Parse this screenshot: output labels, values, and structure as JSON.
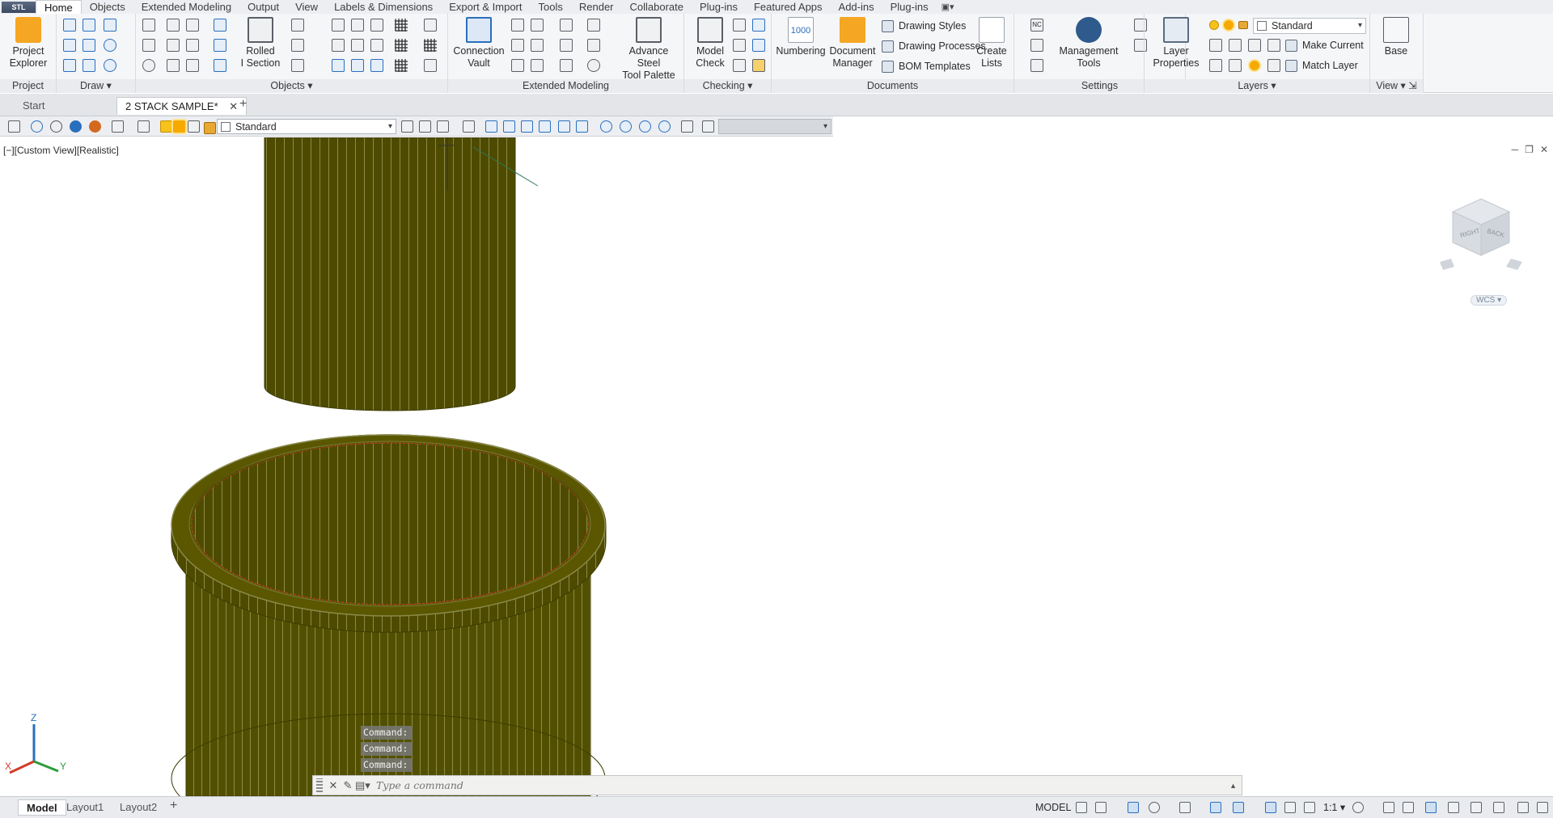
{
  "app_button": "STL",
  "tabs": [
    "Home",
    "Objects",
    "Extended Modeling",
    "Output",
    "View",
    "Labels & Dimensions",
    "Export & Import",
    "Tools",
    "Render",
    "Collaborate",
    "Plug-ins",
    "Featured Apps",
    "Add-ins",
    "Plug-ins"
  ],
  "active_tab": "Home",
  "ribbon": {
    "project": {
      "label": "Project",
      "explorer": "Project\nExplorer"
    },
    "draw": {
      "label": "Draw"
    },
    "objects": {
      "label": "Objects",
      "rolled_section": "Rolled\nI Section"
    },
    "extended_modeling": {
      "label": "Extended Modeling",
      "connection_vault": "Connection\nVault",
      "tool_palette": "Advance Steel\nTool Palette"
    },
    "checking": {
      "label": "Checking",
      "model_check": "Model\nCheck"
    },
    "documents": {
      "label": "Documents",
      "numbering": "Numbering",
      "numbering_badge": "1000",
      "document_manager": "Document\nManager",
      "drawing_styles": "Drawing Styles",
      "drawing_processes": "Drawing Processes",
      "bom_templates": "BOM Templates",
      "create_lists": "Create\nLists"
    },
    "settings": {
      "label": "Settings",
      "nc_badge": "NC",
      "management_tools": "Management\nTools"
    },
    "layers": {
      "label": "Layers",
      "layer_properties": "Layer\nProperties",
      "layer_name": "Standard",
      "make_current": "Make Current",
      "match_layer": "Match Layer"
    },
    "view": {
      "label": "View",
      "base": "Base"
    }
  },
  "doc_tabs": {
    "start": "Start",
    "active": "2 STACK SAMPLE*"
  },
  "toolbar": {
    "layer_name": "Standard"
  },
  "viewport": {
    "label": "[−][Custom View][Realistic]",
    "wcs": "WCS",
    "viewcube_right": "RIGHT",
    "viewcube_back": "BACK",
    "axis_x": "X",
    "axis_y": "Y",
    "axis_z": "Z"
  },
  "command": {
    "history": [
      "Command:",
      "Command:",
      "Command:"
    ],
    "placeholder": "Type a command"
  },
  "status": {
    "layouts": [
      "Model",
      "Layout1",
      "Layout2"
    ],
    "model_button": "MODEL",
    "scale": "1:1"
  },
  "colors": {
    "pipe_fill": "#4e4b00",
    "pipe_edge": "#8a8a4a",
    "ribbon_bg": "#f5f6f8",
    "accent": "#2a6fbe"
  }
}
